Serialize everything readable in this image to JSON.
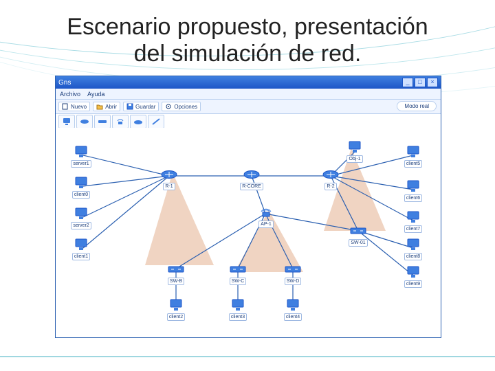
{
  "slide": {
    "title_line1": "Escenario propuesto, presentación",
    "title_line2": "del simulación de red."
  },
  "sim": {
    "window_title": "Gns",
    "menu": {
      "archivo": "Archivo",
      "ayuda": "Ayuda"
    },
    "toolbar": {
      "nuevo": "Nuevo",
      "abrir": "Abrir",
      "guardar": "Guardar",
      "opciones": "Opciones",
      "modo_pill": "Modo real"
    },
    "iconbar": {
      "host": "host",
      "router": "router",
      "switch": "switch",
      "ap": "ap",
      "cloud": "cloud",
      "link": "link"
    },
    "window_controls": {
      "min": "_",
      "max": "□",
      "close": "×"
    },
    "nodes": {
      "server1": {
        "label": "server1",
        "type": "host"
      },
      "client0": {
        "label": "client0",
        "type": "host"
      },
      "server2": {
        "label": "server2",
        "type": "host"
      },
      "client1": {
        "label": "client1",
        "type": "host"
      },
      "r1": {
        "label": "R-1",
        "type": "router"
      },
      "core": {
        "label": "R-CORE",
        "type": "router"
      },
      "r2": {
        "label": "R-2",
        "type": "router"
      },
      "ap1": {
        "label": "AP-1",
        "type": "ap"
      },
      "swb": {
        "label": "SW-B",
        "type": "switch"
      },
      "swc": {
        "label": "SW-C",
        "type": "switch"
      },
      "swd": {
        "label": "SW-D",
        "type": "switch"
      },
      "swe": {
        "label": "SW-01",
        "type": "switch"
      },
      "client2": {
        "label": "client2",
        "type": "host"
      },
      "client3": {
        "label": "client3",
        "type": "host"
      },
      "client4": {
        "label": "client4",
        "type": "host"
      },
      "obj1": {
        "label": "Obj-1",
        "type": "host"
      },
      "client5": {
        "label": "client5",
        "type": "host"
      },
      "client6": {
        "label": "client6",
        "type": "host"
      },
      "client7": {
        "label": "client7",
        "type": "host"
      },
      "client8": {
        "label": "client8",
        "type": "host"
      },
      "client9": {
        "label": "client9",
        "type": "host"
      }
    }
  }
}
